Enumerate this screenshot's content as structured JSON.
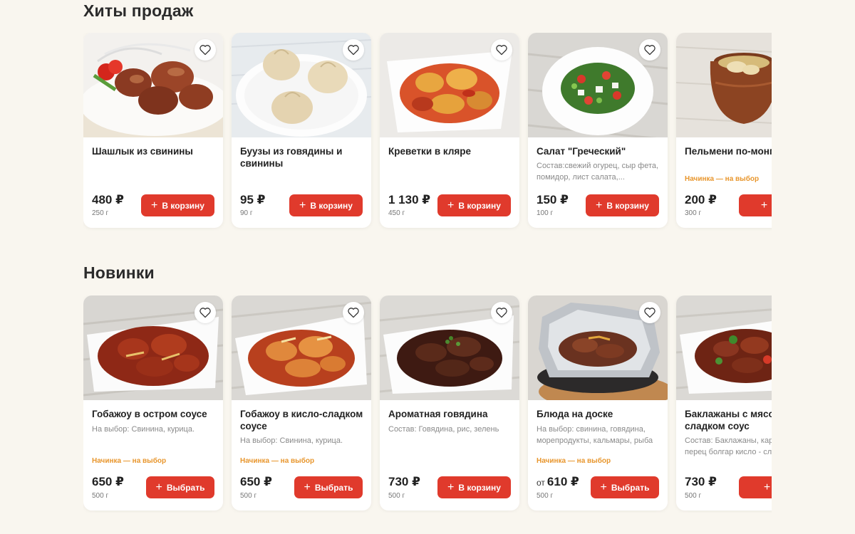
{
  "hits": {
    "title": "Хиты продаж",
    "items": [
      {
        "name": "Шашлык из свинины",
        "desc": "",
        "filling": "",
        "price_prefix": "",
        "price": "480 ₽",
        "weight": "250 г",
        "button": "В корзину",
        "photo": "shashlik"
      },
      {
        "name": "Буузы из говядины и свинины",
        "desc": "",
        "filling": "",
        "price_prefix": "",
        "price": "95 ₽",
        "weight": "90 г",
        "button": "В корзину",
        "photo": "buuzy"
      },
      {
        "name": "Креветки в кляре",
        "desc": "",
        "filling": "",
        "price_prefix": "",
        "price": "1 130 ₽",
        "weight": "450 г",
        "button": "В корзину",
        "photo": "shrimp"
      },
      {
        "name": "Салат \"Греческий\"",
        "desc": "Состав:свежий огурец, сыр фета, помидор, лист салата,...",
        "filling": "",
        "price_prefix": "",
        "price": "150 ₽",
        "weight": "100 г",
        "button": "В корзину",
        "photo": "salad"
      },
      {
        "name": "Пельмени по-монг",
        "desc": "",
        "filling": "Начинка — на выбор",
        "price_prefix": "",
        "price": "200 ₽",
        "weight": "300 г",
        "button": "Вы",
        "photo": "pelmeni"
      }
    ]
  },
  "news": {
    "title": "Новинки",
    "items": [
      {
        "name": "Гобажоу в остром соусе",
        "desc": "На выбор: Свинина, курица.",
        "filling": "Начинка — на выбор",
        "price_prefix": "",
        "price": "650 ₽",
        "weight": "500 г",
        "button": "Выбрать",
        "photo": "gobajou1"
      },
      {
        "name": "Гобажоу в кисло-сладком соусе",
        "desc": "На выбор: Свинина, курица.",
        "filling": "Начинка — на выбор",
        "price_prefix": "",
        "price": "650 ₽",
        "weight": "500 г",
        "button": "Выбрать",
        "photo": "gobajou2"
      },
      {
        "name": "Ароматная говядина",
        "desc": "Состав: Говядина, рис, зелень",
        "filling": "",
        "price_prefix": "",
        "price": "730 ₽",
        "weight": "500 г",
        "button": "В корзину",
        "photo": "beef"
      },
      {
        "name": "Блюда на доске",
        "desc": "На выбор: свинина, говядина, морепродукты, кальмары, рыба",
        "filling": "Начинка — на выбор",
        "price_prefix": "от",
        "price": "610 ₽",
        "weight": "500 г",
        "button": "Выбрать",
        "photo": "board"
      },
      {
        "name": "Баклажаны с мясом кисло-сладком соус",
        "desc": "Состав: Баклажаны, кар свинина, перец болгар кисло - сладкий соус.",
        "filling": "",
        "price_prefix": "",
        "price": "730 ₽",
        "weight": "500 г",
        "button": "В к",
        "photo": "eggplant"
      }
    ]
  },
  "colors": {
    "accent": "#e03a2c",
    "filling_text": "#e8962d",
    "background": "#f9f6ef"
  },
  "icons": {
    "favorite": "heart-icon",
    "add": "plus-icon"
  }
}
